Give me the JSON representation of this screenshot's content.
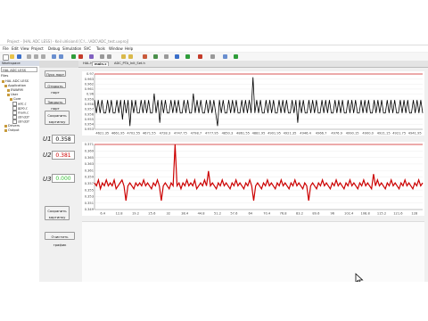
{
  "window": {
    "title": "Project - [HAL ADC LESS] - Keil uVision4 [C:\\...\\ADC\\ADC_test.uvproj]"
  },
  "menu": [
    "File",
    "Edit",
    "View",
    "Project",
    "Debug",
    "Simulation",
    "SVC",
    "Tools",
    "Window",
    "Help"
  ],
  "workspace": {
    "title": "Workspace",
    "combo": "HAL ADC LESS",
    "files_label": "Files",
    "tree": [
      "HAL ADC LESS",
      "Application",
      "EWARM",
      "User",
      "Core",
      "adc.c",
      "gpio.c",
      "main.c",
      "stm32f",
      "stm32f",
      "Drivers",
      "Output"
    ]
  },
  "tabs": [
    "HAL.h",
    "main.c",
    "ADC_PTA_Init_Set.h"
  ],
  "buttons": {
    "start": "Пуск порт",
    "open_port": "Открыть порт",
    "close_port": "Закрыть порт",
    "save_image": "Сохранить картинку",
    "save_image2": "Сохранить картинку",
    "clear_graph": "Очистить график"
  },
  "readouts": {
    "u1_label": "U1",
    "u1_value": "0.358",
    "u2_label": "U2",
    "u2_value": "0.381",
    "u3_label": "U3",
    "u3_value": "0.000"
  },
  "chart_data": [
    {
      "type": "line",
      "y_ticks": [
        "0.97",
        "0.963",
        "0.962",
        "0.961",
        "0.96",
        "0.959",
        "0.958",
        "0.957",
        "0.956",
        "0.955",
        "0.954",
        "0.953"
      ],
      "x_ticks": [
        "4621.35",
        "4661.95",
        "4702.55",
        "4671.55",
        "4728.3",
        "4747.75",
        "4798.7",
        "4777.95",
        "4850.3",
        "4861.55",
        "4881.95",
        "4901.95",
        "4921.35",
        "4946.4",
        "4966.7",
        "4976.9",
        "4990.15",
        "4900.0",
        "4921.15",
        "4921.75",
        "4941.95"
      ],
      "ylim": [
        0.953,
        0.97
      ],
      "series": [
        {
          "color": "#000000",
          "values": [
            0.962,
            0.958,
            0.962,
            0.958,
            0.962,
            0.958,
            0.958,
            0.962,
            0.958,
            0.962,
            0.958,
            0.958,
            0.962,
            0.958,
            0.962,
            0.956,
            0.962,
            0.958,
            0.962,
            0.954,
            0.962,
            0.958,
            0.962,
            0.958,
            0.958,
            0.962,
            0.958,
            0.962,
            0.958,
            0.962,
            0.958,
            0.958,
            0.964,
            0.958,
            0.962,
            0.955,
            0.962,
            0.958,
            0.962,
            0.958,
            0.958,
            0.962,
            0.958,
            0.962,
            0.958,
            0.962,
            0.958,
            0.958,
            0.962,
            0.958,
            0.962,
            0.958,
            0.958,
            0.964,
            0.958,
            0.962,
            0.958,
            0.962,
            0.958,
            0.958,
            0.962,
            0.958,
            0.962,
            0.958,
            0.962,
            0.958,
            0.954,
            0.962,
            0.958,
            0.962,
            0.958,
            0.958,
            0.962,
            0.958,
            0.962,
            0.958,
            0.962,
            0.958,
            0.958,
            0.962,
            0.958,
            0.962,
            0.958,
            0.962,
            0.958,
            0.969,
            0.958,
            0.962,
            0.958,
            0.962,
            0.958,
            0.958,
            0.962,
            0.958,
            0.962,
            0.958,
            0.962,
            0.958,
            0.958,
            0.962,
            0.958,
            0.962,
            0.958,
            0.962,
            0.958,
            0.958,
            0.962,
            0.958,
            0.962,
            0.955,
            0.962,
            0.958,
            0.962,
            0.958,
            0.958,
            0.962,
            0.958,
            0.962,
            0.958,
            0.962,
            0.958,
            0.958,
            0.962,
            0.958,
            0.962,
            0.958,
            0.962,
            0.958,
            0.958,
            0.962,
            0.958,
            0.962,
            0.958,
            0.962,
            0.958,
            0.958,
            0.962,
            0.958,
            0.962,
            0.958,
            0.962,
            0.958,
            0.958,
            0.962,
            0.958,
            0.962,
            0.958,
            0.962,
            0.958,
            0.958,
            0.962,
            0.958,
            0.962,
            0.958,
            0.962,
            0.958,
            0.958,
            0.962,
            0.958,
            0.962,
            0.958,
            0.962,
            0.958,
            0.958,
            0.962,
            0.958,
            0.962,
            0.958,
            0.962,
            0.958,
            0.958,
            0.962,
            0.958,
            0.962,
            0.958,
            0.962,
            0.958
          ]
        }
      ]
    },
    {
      "type": "line",
      "y_ticks": [
        "0.371",
        "0.369",
        "0.365",
        "0.363",
        "0.361",
        "0.359",
        "0.357",
        "0.355",
        "0.353",
        "0.351",
        "0.349"
      ],
      "x_ticks": [
        "6.4",
        "12.8",
        "19.2",
        "25.6",
        "32",
        "38.4",
        "44.8",
        "51.2",
        "57.6",
        "64",
        "70.4",
        "76.8",
        "83.2",
        "89.6",
        "96",
        "102.4",
        "108.8",
        "115.2",
        "121.6",
        "128"
      ],
      "ylim": [
        0.349,
        0.371
      ],
      "series": [
        {
          "color": "#cc0000",
          "values": [
            0.358,
            0.357,
            0.359,
            0.356,
            0.358,
            0.357,
            0.359,
            0.357,
            0.358,
            0.357,
            0.359,
            0.356,
            0.357,
            0.358,
            0.359,
            0.357,
            0.352,
            0.357,
            0.358,
            0.357,
            0.356,
            0.358,
            0.357,
            0.358,
            0.357,
            0.359,
            0.357,
            0.358,
            0.357,
            0.356,
            0.358,
            0.357,
            0.359,
            0.357,
            0.352,
            0.357,
            0.358,
            0.357,
            0.356,
            0.358,
            0.357,
            0.371,
            0.357,
            0.358,
            0.356,
            0.358,
            0.357,
            0.359,
            0.357,
            0.358,
            0.357,
            0.359,
            0.356,
            0.357,
            0.358,
            0.357,
            0.359,
            0.357,
            0.362,
            0.357,
            0.358,
            0.357,
            0.356,
            0.358,
            0.357,
            0.359,
            0.357,
            0.358,
            0.357,
            0.356,
            0.358,
            0.357,
            0.359,
            0.357,
            0.358,
            0.357,
            0.356,
            0.358,
            0.357,
            0.359,
            0.357,
            0.352,
            0.357,
            0.358,
            0.357,
            0.356,
            0.358,
            0.357,
            0.359,
            0.357,
            0.358,
            0.357,
            0.356,
            0.358,
            0.357,
            0.359,
            0.357,
            0.358,
            0.357,
            0.356,
            0.358,
            0.357,
            0.359,
            0.357,
            0.358,
            0.357,
            0.356,
            0.358,
            0.357,
            0.352,
            0.357,
            0.358,
            0.357,
            0.356,
            0.358,
            0.357,
            0.359,
            0.357,
            0.358,
            0.357,
            0.356,
            0.358,
            0.357,
            0.359,
            0.357,
            0.358,
            0.357,
            0.356,
            0.358,
            0.357,
            0.359,
            0.357,
            0.358,
            0.357,
            0.356,
            0.358,
            0.357,
            0.359,
            0.357,
            0.358,
            0.357,
            0.356,
            0.361,
            0.357,
            0.359,
            0.357,
            0.358,
            0.357,
            0.356,
            0.358,
            0.357,
            0.359,
            0.357,
            0.358,
            0.357,
            0.356,
            0.358,
            0.357,
            0.359,
            0.357,
            0.358,
            0.357,
            0.356,
            0.358,
            0.357,
            0.359,
            0.357,
            0.358
          ]
        }
      ]
    }
  ]
}
